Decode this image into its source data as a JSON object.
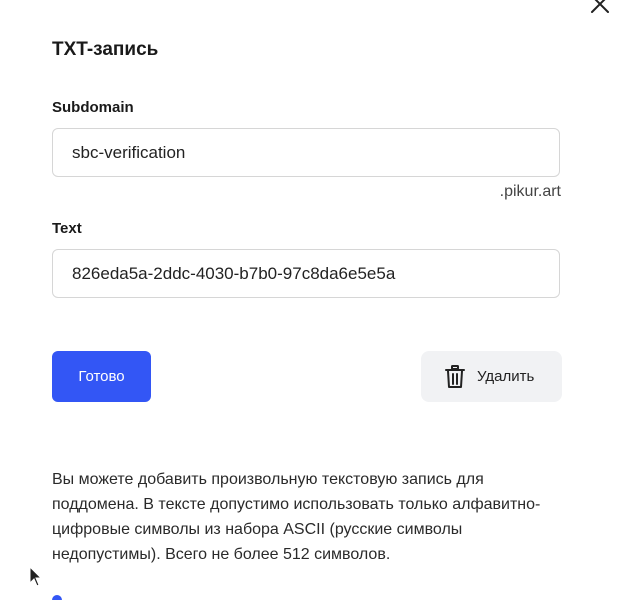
{
  "dialog": {
    "title": "TXT-запись",
    "close_icon": "close-icon"
  },
  "subdomain": {
    "label": "Subdomain",
    "value": "sbc-verification",
    "suffix": ".pikur.art"
  },
  "text": {
    "label": "Text",
    "value": "826eda5a-2ddc-4030-b7b0-97c8da6e5e5a"
  },
  "actions": {
    "done_label": "Готово",
    "delete_label": "Удалить",
    "delete_icon": "trash-icon"
  },
  "info": {
    "text": "Вы можете добавить произвольную текстовую запись для поддомена. В тексте допустимо использовать только алфавитно-цифровые символы из набора ASCII (русские символы недопустимы). Всего не более 512 символов."
  },
  "colors": {
    "primary": "#3356f5",
    "secondary_bg": "#f1f2f4",
    "border": "#d6d6d6"
  }
}
